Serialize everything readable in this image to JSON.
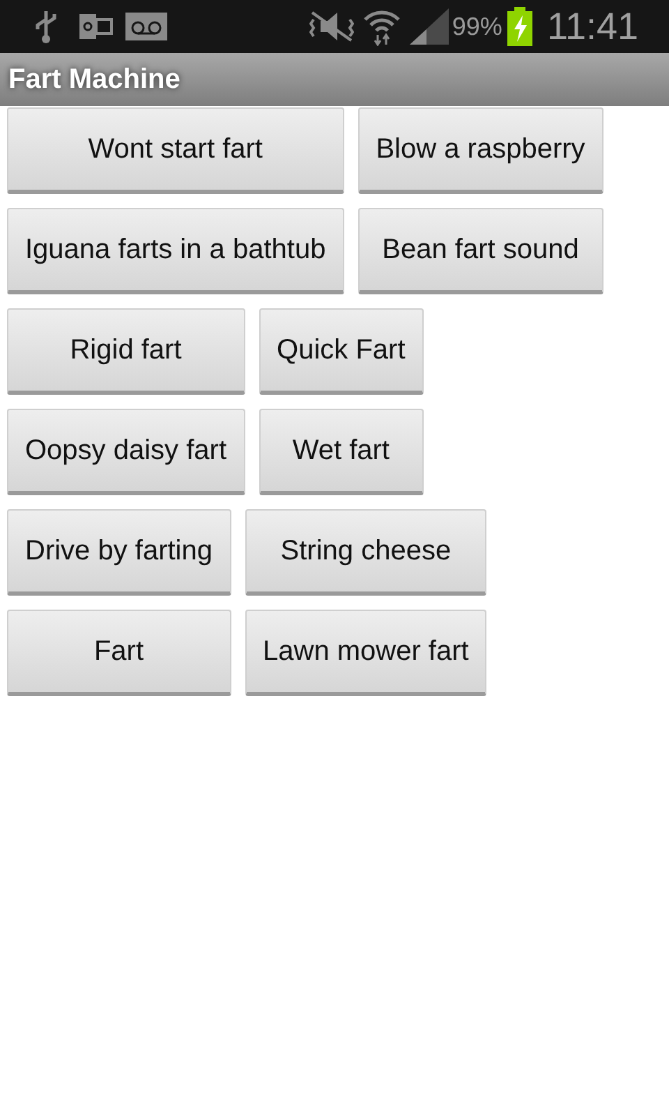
{
  "status_bar": {
    "battery": "99%",
    "time": "11:41"
  },
  "app_bar": {
    "title": "Fart Machine"
  },
  "button_groups": [
    {
      "rows": [
        [
          "Wont start fart",
          "Blow a raspberry"
        ],
        [
          "Iguana farts in a bathtub",
          "Bean fart sound"
        ]
      ]
    },
    {
      "rows": [
        [
          "Rigid fart",
          "Quick Fart"
        ],
        [
          "Oopsy daisy fart",
          "Wet fart"
        ]
      ]
    },
    {
      "rows": [
        [
          "Drive by farting",
          "String cheese"
        ],
        [
          "Fart",
          "Lawn mower fart"
        ]
      ]
    }
  ]
}
